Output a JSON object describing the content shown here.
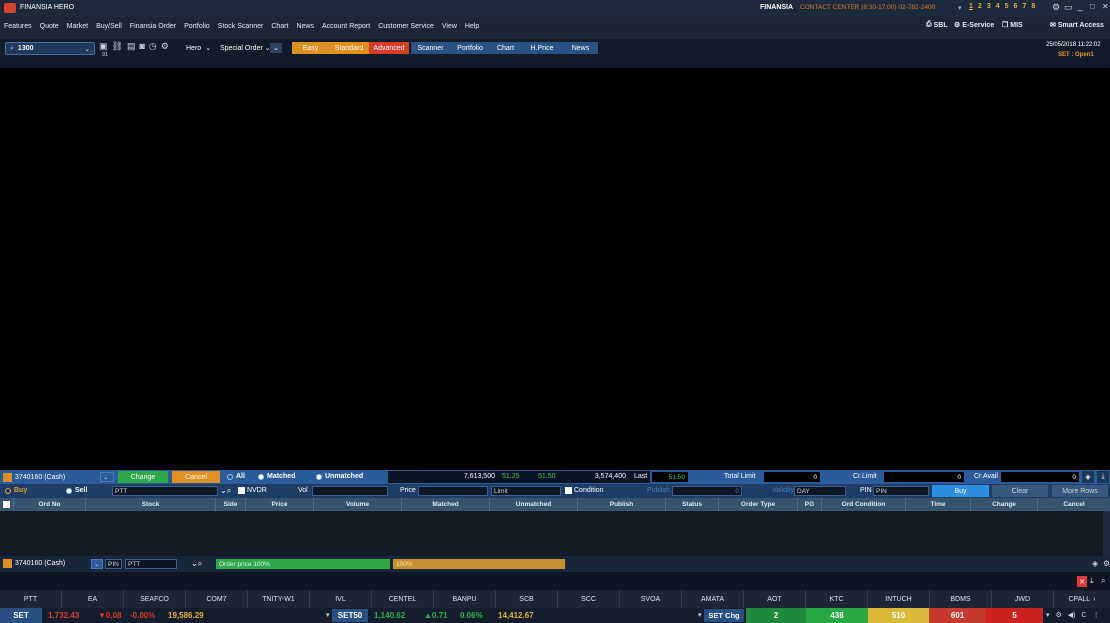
{
  "titlebar": {
    "app_title": "FINANSIA HERO",
    "brand": "FINANSIA",
    "contact": "CONTACT CENTER (8:30-17:00) 02-782-2400",
    "workspaces": [
      "1",
      "2",
      "3",
      "4",
      "5",
      "6",
      "7",
      "8"
    ],
    "window_controls": [
      "minimize-icon",
      "restore-icon",
      "close-icon"
    ]
  },
  "menubar": {
    "items": [
      "Features",
      "Quote",
      "Market",
      "Buy/Sell",
      "Finansia Order",
      "Portfolio",
      "Stock Scanner",
      "Chart",
      "News",
      "Account Report",
      "Customer Service",
      "View",
      "Help"
    ],
    "right_buttons": [
      "SBL",
      "E-Service",
      "MIS",
      "Smart Access"
    ]
  },
  "toolbar": {
    "search_value": "1300",
    "small_badge": "91",
    "hero_label": "Hero",
    "special_order_label": "Special Order",
    "tabs": [
      "Easy",
      "Standard",
      "Advanced",
      "Scanner",
      "Portfolio",
      "Chart",
      "H.Price",
      "News"
    ],
    "datetime": "25/05/2018 11:22:02",
    "market_status": "SET : Open1"
  },
  "orderbar": {
    "account": "3740160 (Cash)",
    "change_label": "Change",
    "cancel_label": "Cancel",
    "filter_all": "All",
    "filter_matched": "Matched",
    "filter_unmatched": "Unmatched",
    "vol_bid": "7,613,500",
    "bid": "51.25",
    "offer": "51.50",
    "vol_offer": "3,574,400",
    "last_label": "Last",
    "last_value": "51.50",
    "total_limit_label": "Total Limit",
    "total_limit_value": "0",
    "cr_limit_label": "Cr.Limit",
    "cr_limit_value": "0",
    "cr_avail_label": "Cr.Avail",
    "cr_avail_value": "0"
  },
  "entrybar": {
    "buy_label": "Buy",
    "sell_label": "Sell",
    "stock_value": "PTT",
    "nvdr_label": "NVDR",
    "vol_label": "Vol",
    "price_label": "Price",
    "limit_value": "Limit",
    "condition_label": "Condition",
    "publish_label": "Publish",
    "publish_value": "0",
    "validity_label": "Validity",
    "validity_value": "DAY",
    "pin_label": "PIN",
    "pin_placeholder": "PIN",
    "buy_button": "Buy",
    "clear_button": "Clear",
    "more_rows_button": "More Rows"
  },
  "grid": {
    "headers": [
      "Ord No",
      "Stock",
      "Side",
      "Price",
      "Volume",
      "Matched",
      "Unmatched",
      "Publish",
      "Status",
      "Order Type",
      "PG",
      "Ord Condition",
      "Time",
      "Change",
      "Cancel"
    ]
  },
  "secondbar": {
    "account": "3740160 (Cash)",
    "pin_value": "PIN",
    "stock_value": "PTT",
    "order_price": "Order price 100%",
    "percent": "100%"
  },
  "ticker": {
    "items": [
      "PTT",
      "EA",
      "SEAFCO",
      "COM7",
      "TNITY-W1",
      "IVL",
      "CENTEL",
      "BANPU",
      "SCB",
      "SCC",
      "SVOA",
      "AMATA",
      "AOT",
      "KTC",
      "INTUCH",
      "BDMS",
      "JWD",
      "CPALL"
    ]
  },
  "indexbar": {
    "set_label": "SET",
    "set_value": "1,732.43",
    "set_change": "▼0.08",
    "set_pct": "-0.00%",
    "set_volume": "19,586.29",
    "set50_label": "SET50",
    "set50_value": "1,140.62",
    "set50_change": "▲0.71",
    "set50_pct": "0.06%",
    "set50_volume": "14,412.67",
    "setchg_label": "SET Chg",
    "stats": [
      {
        "value": "2",
        "color": "#1e8a3a"
      },
      {
        "value": "438",
        "color": "#27a843"
      },
      {
        "value": "510",
        "color": "#d9b93a"
      },
      {
        "value": "601",
        "color": "#c73a2f"
      },
      {
        "value": "5",
        "color": "#cc2222"
      }
    ]
  },
  "colors": {
    "accent_orange": "#e0901e",
    "buy_blue": "#2c8fe0",
    "green": "#2fa848",
    "red": "#c8302a"
  }
}
